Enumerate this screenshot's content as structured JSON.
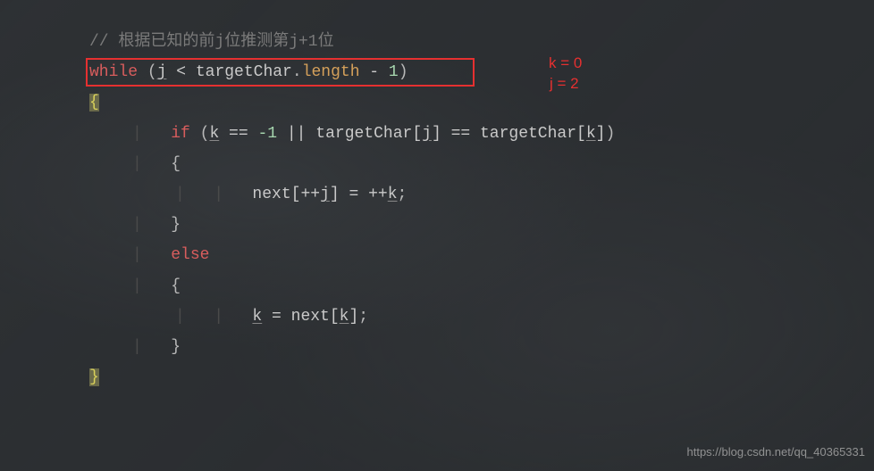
{
  "code": {
    "comment": "// 根据已知的前j位推测第j+1位",
    "while_kw": "while",
    "open_paren": " (",
    "var_j": "j",
    "lt": " < ",
    "targetChar": "targetChar",
    "dot": ".",
    "length": "length",
    "minus": " - ",
    "one": "1",
    "close_paren": ")",
    "brace_open": "{",
    "if_kw": "if",
    "if_open": " (",
    "var_k": "k",
    "eqeq": " == ",
    "neg1": "-1",
    "or": " || ",
    "targetChar2": "targetChar",
    "br_open": "[",
    "var_j2": "j",
    "br_close": "]",
    "eqeq2": " == ",
    "targetChar3": "targetChar",
    "br_open2": "[",
    "var_k2": "k",
    "br_close2": "]",
    "if_close": ")",
    "brace_open2": "{",
    "next": "next",
    "br_open3": "[",
    "preinc_j": "++",
    "var_j3": "j",
    "br_close3": "]",
    "assign": " = ",
    "preinc_k": "++",
    "var_k3": "k",
    "semi": ";",
    "brace_close2": "}",
    "else_kw": "else",
    "brace_open3": "{",
    "var_k4": "k",
    "assign2": " = ",
    "next2": "next",
    "br_open4": "[",
    "var_k5": "k",
    "br_close4": "]",
    "semi2": ";",
    "brace_close3": "}",
    "brace_close1": "}"
  },
  "annotations": {
    "k": "k = 0",
    "j": "j = 2"
  },
  "watermark": "https://blog.csdn.net/qq_40365331"
}
